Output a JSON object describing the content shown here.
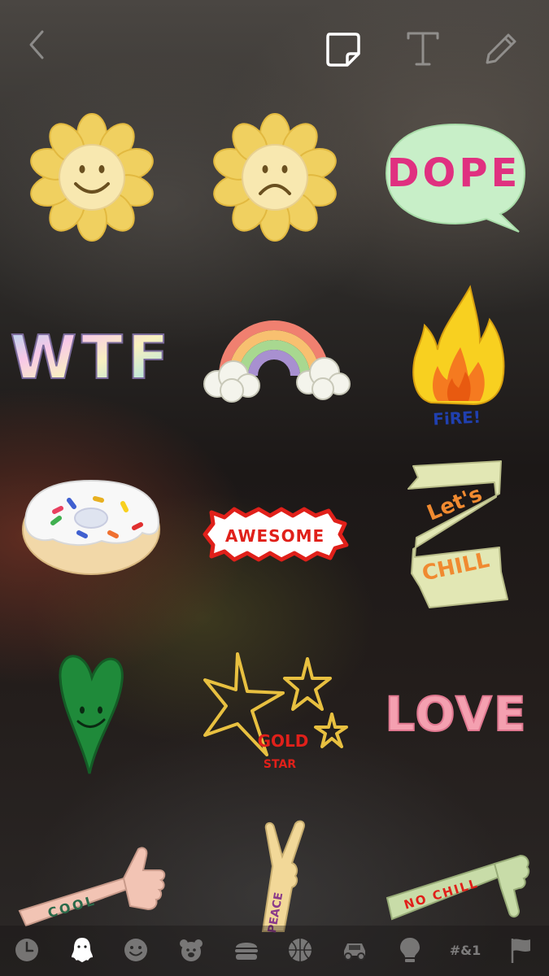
{
  "toolbar": {
    "back": "back",
    "sticker": "sticker",
    "text": "text",
    "draw": "draw"
  },
  "stickers": {
    "dope": "DOPE",
    "wtf": "WTF",
    "fire": "FiRE!",
    "awesome": "AWESOME",
    "lets": "Let's",
    "chill": "CHILL",
    "gold": "GOLD",
    "star": "STAR",
    "love": "LOVE",
    "cool": "COOL",
    "peace": "PEACE",
    "no_chill": "NO CHILL"
  },
  "categories": {
    "symbols_label": "#&1"
  },
  "colors": {
    "flower": "#f0d060",
    "flower_center": "#f8e8b0",
    "dope_bubble": "#c8efc8",
    "love": "#f4a0b0",
    "heart": "#1f8a3a",
    "fire_yellow": "#f8d020",
    "fire_orange": "#f57a20",
    "awesome_red": "#e0201a",
    "ribbon": "#e2e7b4",
    "ribbon_text": "#f08a30",
    "star_gold": "#e8c040",
    "gold_star_text": "#e0201a",
    "active_icon": "#ffffff"
  }
}
